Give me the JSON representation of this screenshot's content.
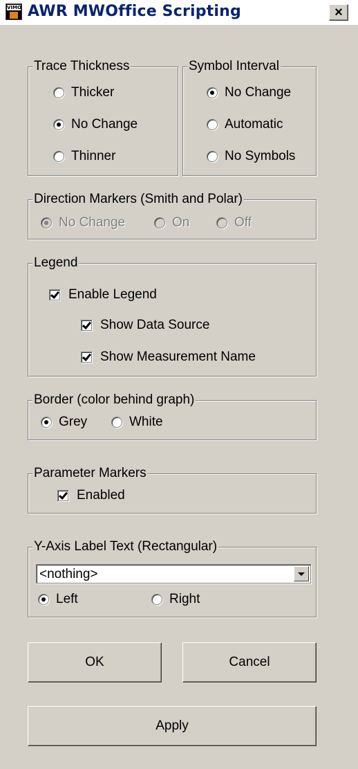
{
  "window": {
    "title": "AWR MWOffice Scripting",
    "icon_text": "VIMO",
    "close_label": "×"
  },
  "trace_thickness": {
    "label": "Trace Thickness",
    "options": [
      {
        "label": "Thicker",
        "checked": false
      },
      {
        "label": "No Change",
        "checked": true
      },
      {
        "label": "Thinner",
        "checked": false
      }
    ]
  },
  "symbol_interval": {
    "label": "Symbol Interval",
    "options": [
      {
        "label": "No Change",
        "checked": true
      },
      {
        "label": "Automatic",
        "checked": false
      },
      {
        "label": "No Symbols",
        "checked": false
      }
    ]
  },
  "direction_markers": {
    "label": "Direction Markers (Smith and Polar)",
    "disabled": true,
    "options": [
      {
        "label": "No Change",
        "checked": true
      },
      {
        "label": "On",
        "checked": false
      },
      {
        "label": "Off",
        "checked": false
      }
    ]
  },
  "legend": {
    "label": "Legend",
    "enable": {
      "label": "Enable Legend",
      "checked": true
    },
    "show_data_source": {
      "label": "Show Data Source",
      "checked": true
    },
    "show_measurement_name": {
      "label": "Show Measurement Name",
      "checked": true
    }
  },
  "border": {
    "label": "Border (color behind graph)",
    "options": [
      {
        "label": "Grey",
        "checked": true
      },
      {
        "label": "White",
        "checked": false
      }
    ]
  },
  "parameter_markers": {
    "label": "Parameter Markers",
    "enabled": {
      "label": "Enabled",
      "checked": true
    }
  },
  "y_axis_label": {
    "label": "Y-Axis Label Text (Rectangular)",
    "selected": "<nothing>",
    "options": [
      {
        "label": "Left",
        "checked": true
      },
      {
        "label": "Right",
        "checked": false
      }
    ]
  },
  "buttons": {
    "ok": "OK",
    "cancel": "Cancel",
    "apply": "Apply"
  },
  "colors": {
    "face": "#d4d0c8",
    "title_text": "#0a246a",
    "shadow": "#808080",
    "highlight": "#ffffff"
  }
}
